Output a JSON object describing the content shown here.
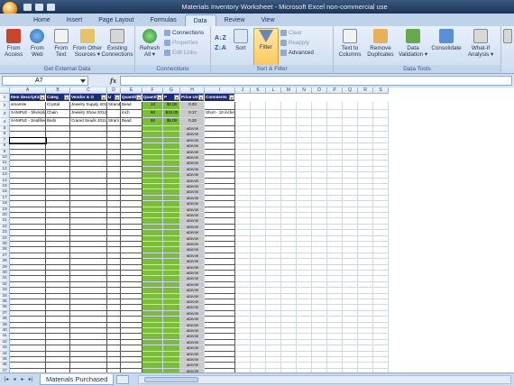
{
  "window": {
    "title": "Materials Inventory Worksheet - Microsoft Excel non-commercial use"
  },
  "tabs": [
    {
      "label": "Home",
      "active": false
    },
    {
      "label": "Insert",
      "active": false
    },
    {
      "label": "Page Layout",
      "active": false
    },
    {
      "label": "Formulas",
      "active": false
    },
    {
      "label": "Data",
      "active": true
    },
    {
      "label": "Review",
      "active": false
    },
    {
      "label": "View",
      "active": false
    }
  ],
  "ribbon": {
    "get_external": {
      "label": "Get External Data",
      "buttons": [
        "From\nAccess",
        "From\nWeb",
        "From\nText",
        "From Other\nSources ▾",
        "Existing\nConnections"
      ]
    },
    "connections": {
      "label": "Connections",
      "refresh": "Refresh\nAll ▾",
      "items": [
        "Connections",
        "Properties",
        "Edit Links"
      ]
    },
    "sort_filter": {
      "label": "Sort & Filter",
      "sort_az": "A↓Z",
      "sort_za": "Z↓A",
      "sort": "Sort",
      "filter": "Filter",
      "items": [
        "Clear",
        "Reapply",
        "Advanced"
      ]
    },
    "data_tools": {
      "label": "Data Tools",
      "buttons": [
        "Text to\nColumns",
        "Remove\nDuplicates",
        "Data\nValidation ▾",
        "Consolidate",
        "What-If\nAnalysis ▾"
      ]
    }
  },
  "formula_bar": {
    "name_box": "A7",
    "fx": "fx",
    "value": ""
  },
  "sheet": {
    "columns": [
      "A",
      "B",
      "C",
      "D",
      "E",
      "F",
      "G",
      "H",
      "I",
      "J",
      "K",
      "L",
      "M",
      "N",
      "O",
      "P",
      "Q",
      "R",
      "S"
    ],
    "headers": [
      "Item description",
      "Categ",
      "Vendor & O",
      "U",
      "Quantit Neede",
      "Quantit On",
      "P",
      "Price Unit",
      "Comments"
    ],
    "rows": [
      {
        "num": "2",
        "cells": [
          "amamite",
          "Crystal",
          "Jewelry Supply 2011",
          "Strand",
          "Bead",
          "10",
          "$2.00",
          "0.20",
          ""
        ]
      },
      {
        "num": "3",
        "cells": [
          "SAMPLE - Silverplated chain",
          "Chain",
          "Jewelry Show 2012",
          "",
          "Inch",
          "50",
          "$10.00",
          "0.17",
          "Short - 10 inches"
        ]
      },
      {
        "num": "4",
        "cells": [
          "SAMPLE - Seafilled Glass Beads",
          "Beds",
          "Crared Seads 2011",
          "Strars",
          "Bead",
          "50",
          "$5.00",
          "0.20",
          ""
        ]
      }
    ],
    "error_value": "#DIV/0!",
    "empty_row_numbers": [
      "5",
      "6",
      "7",
      "8",
      "9",
      "10",
      "11",
      "12",
      "13",
      "14",
      "15",
      "16",
      "17",
      "18",
      "19",
      "20",
      "21",
      "22",
      "23",
      "24",
      "25",
      "26",
      "27",
      "28",
      "29",
      "30",
      "31",
      "32",
      "33",
      "34",
      "35",
      "36",
      "37",
      "38",
      "39",
      "40",
      "41",
      "42",
      "43",
      "44",
      "45",
      "46",
      "47"
    ]
  },
  "sheet_tabs": [
    "Materials Purchased"
  ]
}
